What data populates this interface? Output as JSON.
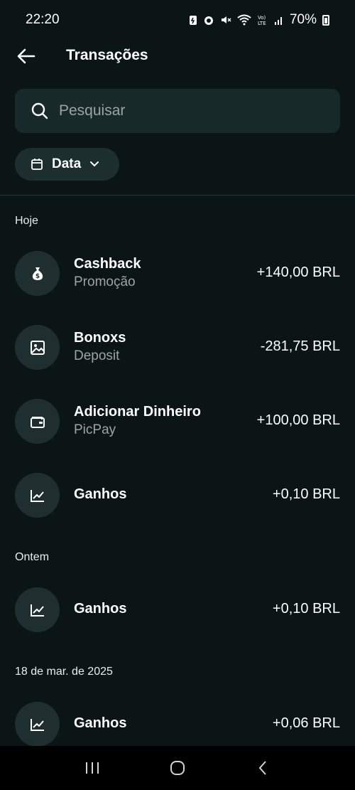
{
  "status_bar": {
    "time": "22:20",
    "battery": "70%",
    "icons": [
      "battery-saver-icon",
      "alarm-icon",
      "mute-icon",
      "wifi-icon",
      "volte-icon",
      "signal-icon",
      "battery-icon"
    ]
  },
  "header": {
    "title": "Transações",
    "back_icon": "arrow-left-icon"
  },
  "search": {
    "placeholder": "Pesquisar"
  },
  "filter": {
    "label": "Data",
    "icon": "calendar-icon"
  },
  "sections": [
    {
      "label": "Hoje",
      "transactions": [
        {
          "title": "Cashback",
          "subtitle": "Promoção",
          "amount": "+140,00 BRL",
          "icon": "money-bag-icon"
        },
        {
          "title": "Bonoxs",
          "subtitle": "Deposit",
          "amount": "-281,75 BRL",
          "icon": "image-icon"
        },
        {
          "title": "Adicionar Dinheiro",
          "subtitle": "PicPay",
          "amount": "+100,00 BRL",
          "icon": "wallet-icon"
        },
        {
          "title": "Ganhos",
          "subtitle": "",
          "amount": "+0,10 BRL",
          "icon": "chart-line-icon"
        }
      ]
    },
    {
      "label": "Ontem",
      "transactions": [
        {
          "title": "Ganhos",
          "subtitle": "",
          "amount": "+0,10 BRL",
          "icon": "chart-line-icon"
        }
      ]
    },
    {
      "label": "18 de mar. de 2025",
      "transactions": [
        {
          "title": "Ganhos",
          "subtitle": "",
          "amount": "+0,06 BRL",
          "icon": "chart-line-icon"
        }
      ]
    }
  ],
  "colors": {
    "background": "#0b1516",
    "surface": "#18292a",
    "muted_text": "#9aa5a5"
  }
}
